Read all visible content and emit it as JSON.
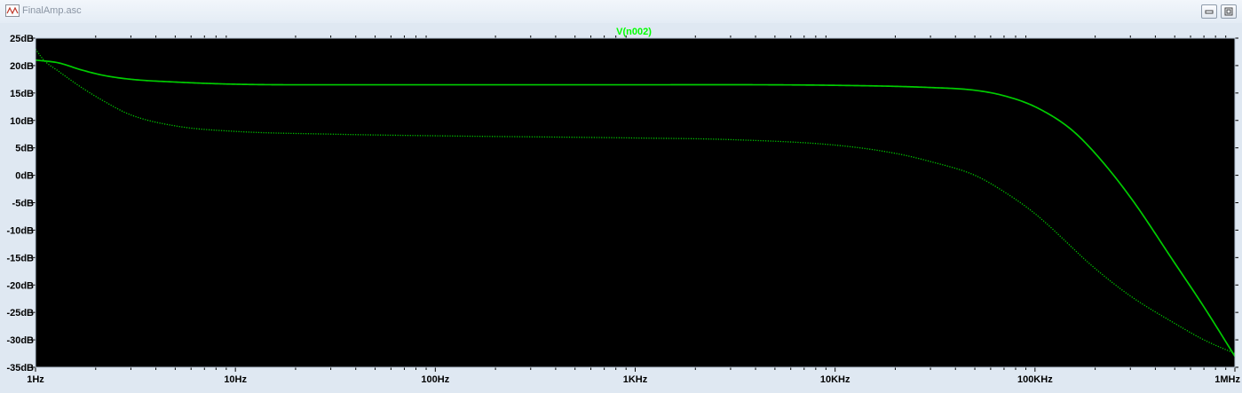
{
  "window": {
    "title": "FinalAmp.asc",
    "app_icon": "schematic-icon",
    "buttons": [
      "minimize-icon",
      "maximize-icon"
    ]
  },
  "colors": {
    "background": "#000000",
    "trace": "#00cc00",
    "title": "#00ff00",
    "frame": "#dfe8f2"
  },
  "chart_data": {
    "type": "line",
    "title": "V(n002)",
    "x_scale": "log",
    "xlim": [
      1,
      1000000
    ],
    "x_tick_labels": [
      "1Hz",
      "10Hz",
      "100Hz",
      "1KHz",
      "10KHz",
      "100KHz",
      "1MHz"
    ],
    "x_ticks": [
      1,
      10,
      100,
      1000,
      10000,
      100000,
      1000000
    ],
    "ylim": [
      -35,
      25
    ],
    "y_tick_labels": [
      "25dB",
      "20dB",
      "15dB",
      "10dB",
      "5dB",
      "0dB",
      "-5dB",
      "-10dB",
      "-15dB",
      "-20dB",
      "-25dB",
      "-30dB",
      "-35dB"
    ],
    "y_ticks": [
      25,
      20,
      15,
      10,
      5,
      0,
      -5,
      -10,
      -15,
      -20,
      -25,
      -30,
      -35
    ],
    "grid": false,
    "series": [
      {
        "style": "solid",
        "x": [
          1,
          1.3,
          1.7,
          2.2,
          3,
          5,
          10,
          30,
          100,
          1000,
          10000,
          30000,
          50000,
          70000,
          100000,
          150000,
          200000,
          300000,
          500000,
          700000,
          1000000
        ],
        "y": [
          21,
          20.5,
          19.2,
          18.2,
          17.5,
          17,
          16.6,
          16.5,
          16.5,
          16.5,
          16.4,
          16,
          15.5,
          14.5,
          12.5,
          8.5,
          4,
          -4,
          -16,
          -24,
          -33
        ]
      },
      {
        "style": "dotted",
        "x": [
          1,
          1.1,
          1.3,
          1.7,
          2.2,
          3,
          5,
          10,
          30,
          100,
          1000,
          3000,
          10000,
          20000,
          30000,
          50000,
          70000,
          100000,
          200000,
          300000,
          500000,
          700000,
          1000000
        ],
        "y": [
          23,
          21,
          19,
          16,
          13.5,
          11,
          9,
          8,
          7.5,
          7.2,
          6.8,
          6.5,
          5.5,
          4,
          2.5,
          0,
          -3,
          -7,
          -17,
          -22,
          -27,
          -30,
          -32.5
        ]
      }
    ]
  }
}
